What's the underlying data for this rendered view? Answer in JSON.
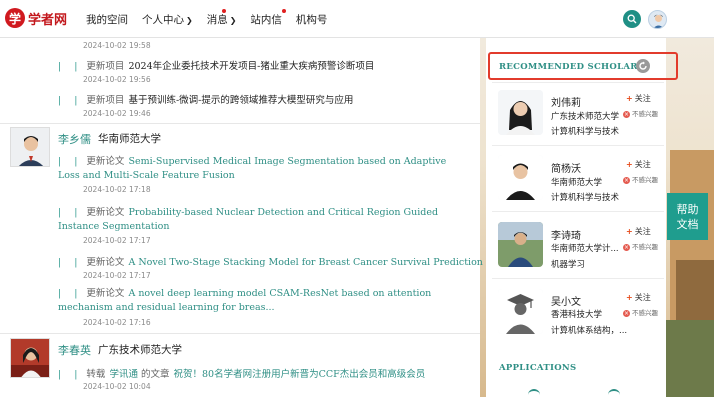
{
  "header": {
    "logo_text": "学者网",
    "logo_mark": "学",
    "nav": [
      {
        "label": "我的空间"
      },
      {
        "label": "个人中心"
      },
      {
        "label": "消息"
      },
      {
        "label": "站内信"
      },
      {
        "label": "机构号"
      }
    ],
    "icons": {
      "search": "search-icon",
      "avatar": "user-avatar"
    }
  },
  "feed": {
    "bar_glyph": "| |",
    "items": [
      {
        "type": "",
        "title": "",
        "date": "2024-10-02 19:58"
      },
      {
        "type": "更新项目",
        "title": "2024年企业委托技术开发项目-猪业重大疾病预警诊断项目",
        "date": "2024-10-02 19:56"
      },
      {
        "type": "更新项目",
        "title": "基于预训练-微调-提示的跨领域推荐大模型研究与应用",
        "date": "2024-10-02 19:46"
      }
    ],
    "people": [
      {
        "name": "李乡儒",
        "school": "华南师范大学",
        "items": [
          {
            "type": "更新论文",
            "title": "Semi-Supervised Medical Image Segmentation based on Adaptive Loss and Multi-Scale Feature Fusion",
            "date": "2024-10-02 17:18"
          },
          {
            "type": "更新论文",
            "title": "Probability-based Nuclear Detection and Critical Region Guided Instance Segmentation",
            "date": "2024-10-02 17:17"
          },
          {
            "type": "更新论文",
            "title": "A Novel Two-Stage Stacking Model for Breast Cancer Survival Prediction",
            "date": "2024-10-02 17:17"
          },
          {
            "type": "更新论文",
            "title": "A novel deep learning model CSAM-ResNet based on attention mechanism and residual learning for breas...",
            "date": "2024-10-02 17:16"
          }
        ]
      },
      {
        "name": "李春英",
        "school": "广东技术师范大学",
        "items": [
          {
            "type": "转载",
            "source": "学讯通",
            "middle": "的文章",
            "title": "祝贺！80名学者网注册用户新晋为CCF杰出会员和高级会员",
            "date": "2024-10-02 10:04"
          }
        ]
      }
    ]
  },
  "sidebar": {
    "recommended_title": "RECOMMENDED SCHOLARS",
    "follow_label": "关注",
    "not_interested_label": "不感兴趣",
    "scholars": [
      {
        "name": "刘伟莉",
        "school": "广东技术师范大学",
        "field": "计算机科学与技术"
      },
      {
        "name": "简杨沃",
        "school": "华南师范大学",
        "field": "计算机科学与技术"
      },
      {
        "name": "李诗琦",
        "school": "华南师范大学计...",
        "field": "机器学习"
      },
      {
        "name": "吴小文",
        "school": "香港科技大学",
        "field": "计算机体系结构，..."
      }
    ],
    "applications_title": "APPLICATIONS"
  },
  "help_button": {
    "line1": "帮助",
    "line2": "文档"
  },
  "colors": {
    "accent": "#2f8f85",
    "brand_red": "#c3181d",
    "highlight_box": "#e23b2c",
    "help_bg": "#1f9d8e"
  }
}
